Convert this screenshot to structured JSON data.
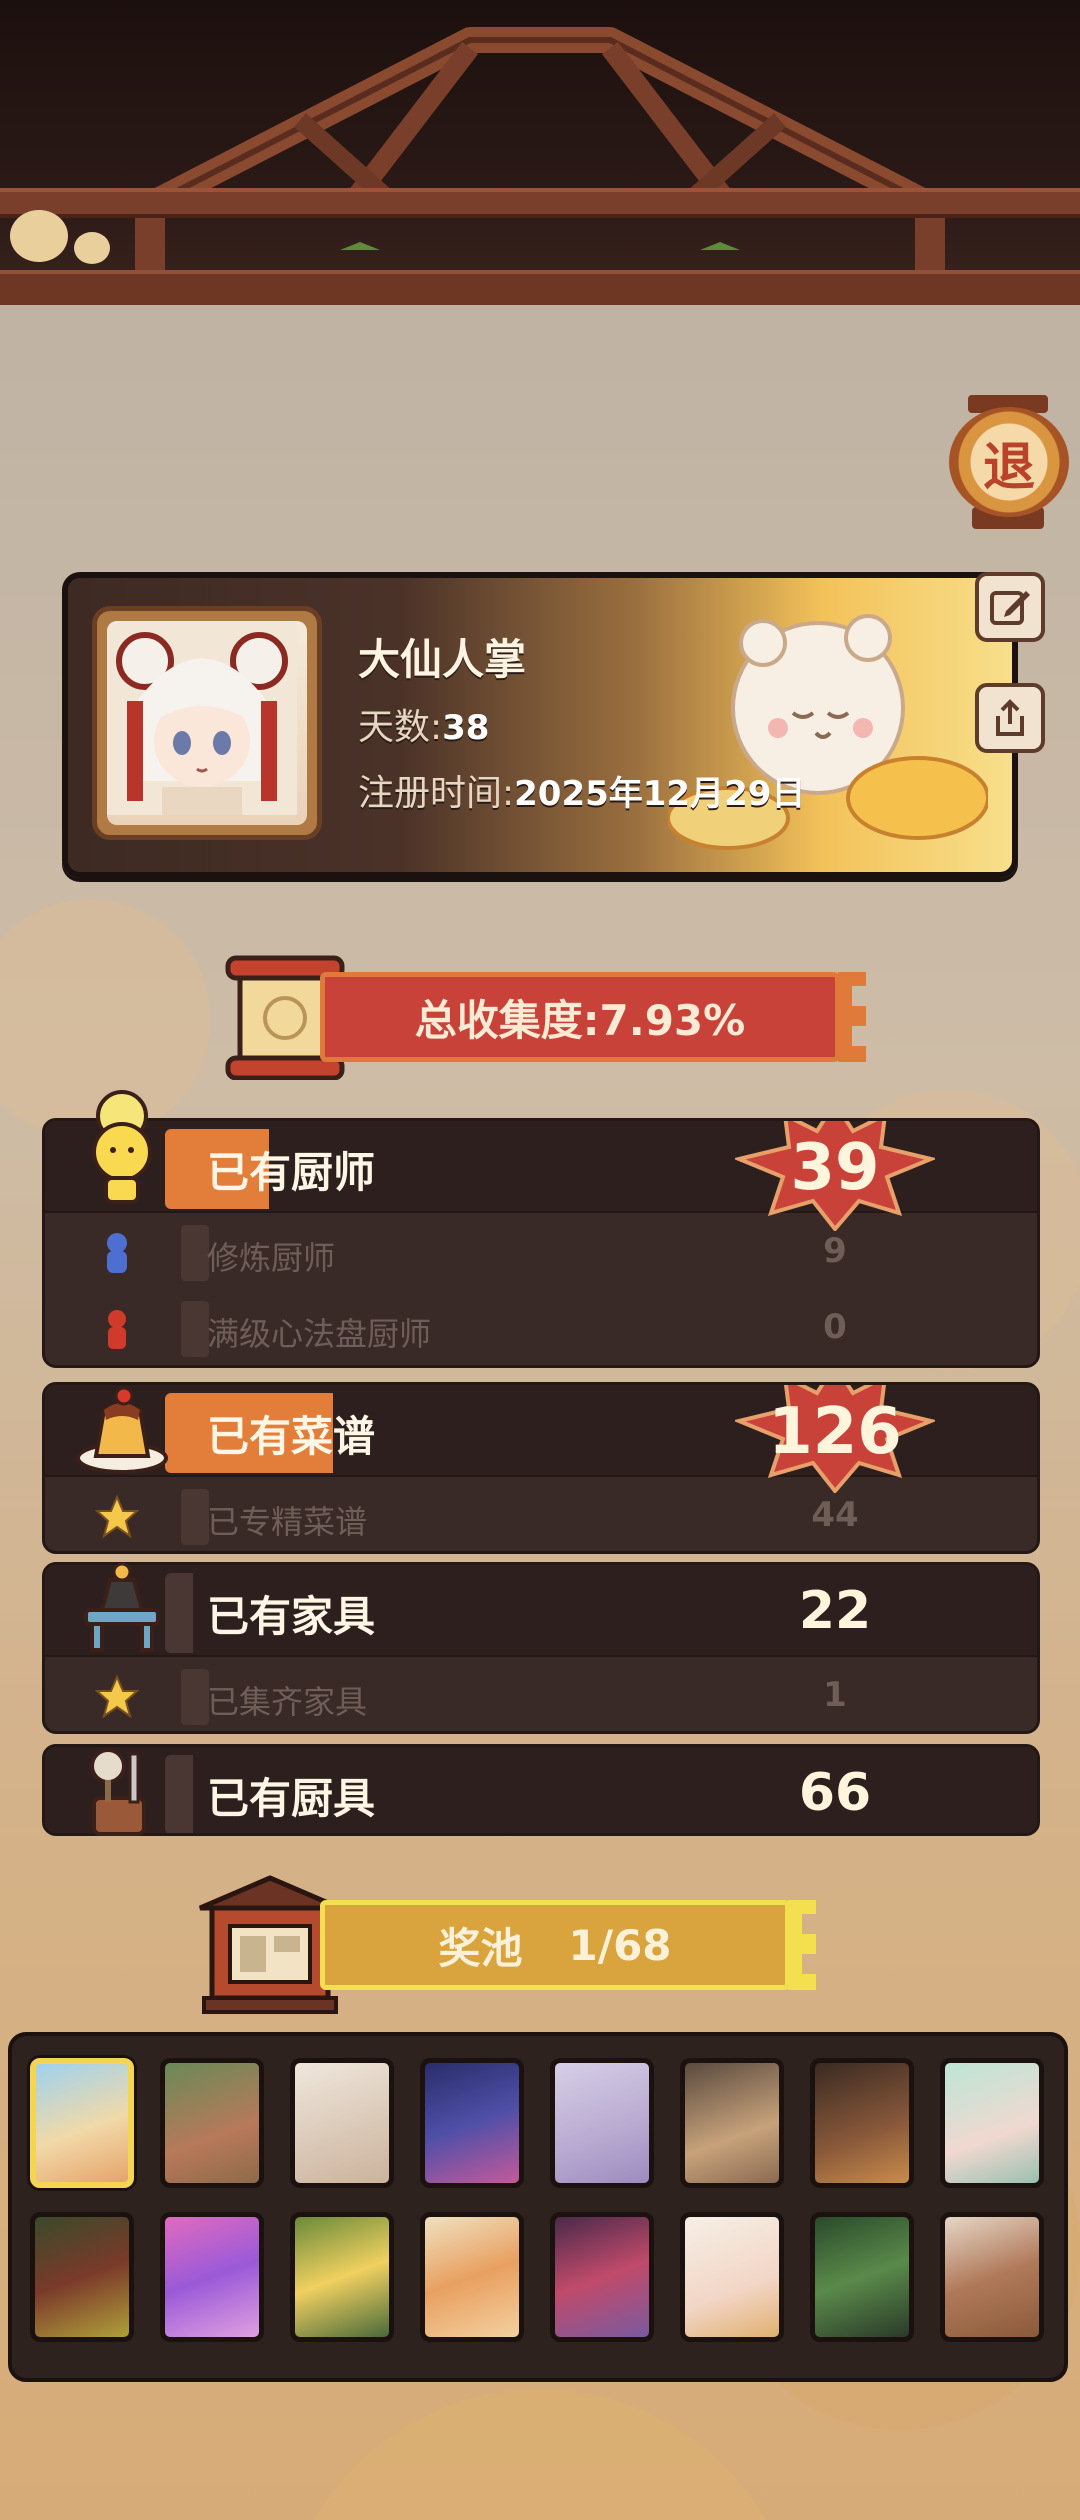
{
  "exit_button": {
    "label": "退"
  },
  "profile": {
    "name": "大仙人掌",
    "days_label": "天数:",
    "days_value": "38",
    "register_label": "注册时间:",
    "register_value": "2025年12月29日"
  },
  "collection": {
    "label": "总收集度:7.93%"
  },
  "stats": {
    "chefs": {
      "label": "已有厨师",
      "value": "39",
      "sub": [
        {
          "label": "修炼厨师",
          "value": "9",
          "icon": "blue-figure-icon"
        },
        {
          "label": "满级心法盘厨师",
          "value": "0",
          "icon": "red-figure-icon"
        }
      ]
    },
    "recipes": {
      "label": "已有菜谱",
      "value": "126",
      "sub": [
        {
          "label": "已专精菜谱",
          "value": "44",
          "icon": "star-icon"
        }
      ]
    },
    "furniture": {
      "label": "已有家具",
      "value": "22",
      "sub": [
        {
          "label": "已集齐家具",
          "value": "1",
          "icon": "star-icon"
        }
      ]
    },
    "kitchenware": {
      "label": "已有厨具",
      "value": "66"
    }
  },
  "prize_pool": {
    "label": "奖池",
    "count": "1/68"
  },
  "colors": {
    "accent_orange": "#e37d3a",
    "banner_red": "#c9423a",
    "banner_yellow": "#d9a33d",
    "selected_border": "#f4d552"
  }
}
